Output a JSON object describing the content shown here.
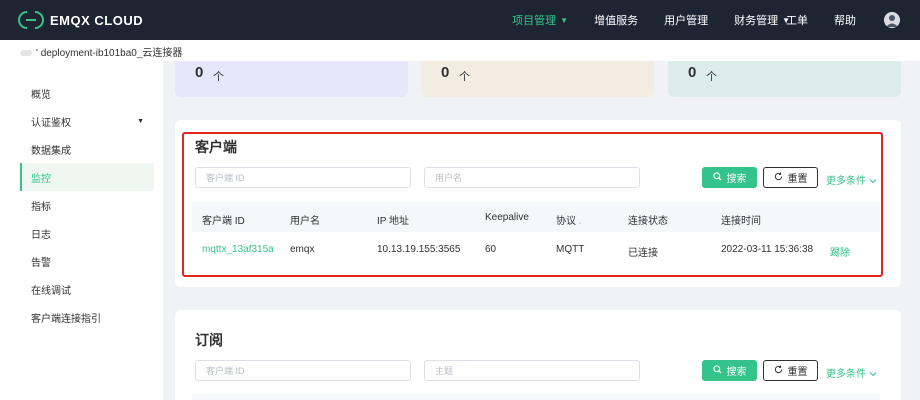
{
  "brand": {
    "name": "EMQX CLOUD"
  },
  "nav": {
    "items": [
      {
        "label": "项目管理",
        "has_caret": true,
        "active": true
      },
      {
        "label": "增值服务",
        "has_caret": false,
        "active": false
      },
      {
        "label": "用户管理",
        "has_caret": false,
        "active": false
      },
      {
        "label": "财务管理",
        "has_caret": true,
        "active": false
      }
    ],
    "ticket": "工单",
    "help": "帮助"
  },
  "breadcrumb": {
    "deployment": "deployment-ib101ba0_云连接器"
  },
  "sidebar": {
    "items": [
      {
        "label": "概览"
      },
      {
        "label": "认证鉴权",
        "has_caret": true
      },
      {
        "label": "数据集成"
      },
      {
        "label": "监控",
        "active": true
      },
      {
        "label": "指标"
      },
      {
        "label": "日志"
      },
      {
        "label": "告警"
      },
      {
        "label": "在线调试"
      },
      {
        "label": "客户端连接指引"
      }
    ]
  },
  "stats": [
    {
      "value": "0",
      "arrow": "个",
      "color": "#e8e6fb"
    },
    {
      "value": "0",
      "arrow": "个",
      "color": "#f2ede0"
    },
    {
      "value": "0",
      "arrow": "个",
      "color": "#dcece9"
    }
  ],
  "clients": {
    "title": "客户端",
    "search": {
      "client_id_placeholder": "客户端 ID",
      "username_placeholder": "用户名",
      "search_label": "搜索",
      "reset_label": "重置",
      "more_label": "更多条件"
    },
    "columns": [
      "客户端 ID",
      "用户名",
      "IP 地址",
      "Keepalive",
      "协议",
      "连接状态",
      "连接时间"
    ],
    "rows": [
      {
        "client_id": "mqttx_13af315a",
        "username": "emqx",
        "ip": "10.13.19.155:3565",
        "keepalive": "60",
        "protocol": "MQTT",
        "status": "已连接",
        "connected_at": "2022-03-11 15:36:38",
        "action": "踢除"
      }
    ]
  },
  "subscriptions": {
    "title": "订阅",
    "search": {
      "client_id_placeholder": "客户端 ID",
      "topic_placeholder": "主题",
      "search_label": "搜索",
      "reset_label": "重置",
      "more_label": "更多条件"
    }
  },
  "colors": {
    "accent": "#34c388",
    "nav_bg": "#1d2532",
    "highlight": "#e0261d"
  }
}
